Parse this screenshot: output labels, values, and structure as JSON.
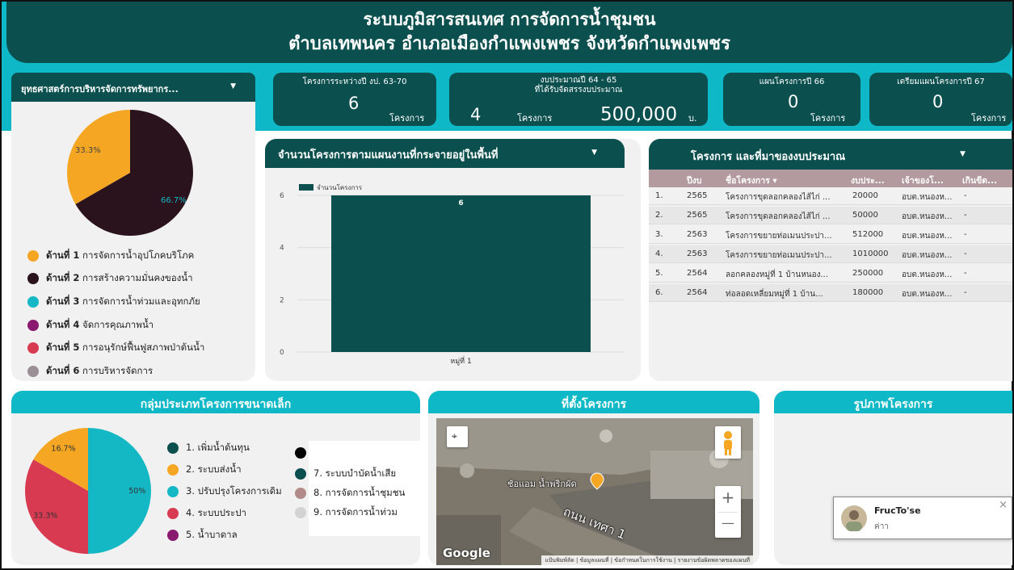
{
  "header": {
    "title_line1": "ระบบภูมิสารสนเทศ การจัดการน้ำชุมชน",
    "title_line2": "ตำบลเทพนคร อำเภอเมืองกำแพงเพชร จังหวัดกำแพงเพชร"
  },
  "filter": {
    "label": "ยุทธศาสตร์การบริหารจัดการทรัพยากร..."
  },
  "kpis": {
    "k1": {
      "label": "โครงการระหว่างปี งป. 63-70",
      "value": "6",
      "unit": "โครงการ"
    },
    "k2": {
      "label_line1": "งบประมาณปี 64 - 65",
      "label_line2": "ที่ได้รับจัดสรรงบประมาณ",
      "count": "4",
      "count_unit": "โครงการ",
      "budget": "500,000",
      "budget_unit": "บ."
    },
    "k3": {
      "label": "แผนโครงการปี 66",
      "value": "0",
      "unit": "โครงการ"
    },
    "k4": {
      "label": "เตรียมแผนโครงการปี 67",
      "value": "0",
      "unit": "โครงการ"
    }
  },
  "strategy_pie": {
    "slices": [
      {
        "label": "33.3%",
        "value": 33.3,
        "color": "#f5a623"
      },
      {
        "label": "66.7%",
        "value": 66.7,
        "color": "#2b131d"
      }
    ],
    "legend": [
      {
        "bold": "ด้านที่ 1",
        "text": "การจัดการน้ำอุปโภคบริโภค",
        "color": "#f5a623"
      },
      {
        "bold": "ด้านที่ 2",
        "text": "การสร้างความมั่นคงของน้ำ",
        "color": "#2b131d"
      },
      {
        "bold": "ด้านที่ 3",
        "text": "การจัดการน้ำท่วมและอุทกภัย",
        "color": "#14b8c4"
      },
      {
        "bold": "ด้านที่ 4",
        "text": "จัดการคุณภาพน้ำ",
        "color": "#8a1a6f"
      },
      {
        "bold": "ด้านที่ 5",
        "text": "การอนุรักษ์ฟื้นฟูสภาพป่าต้นน้ำ",
        "color": "#d83a52"
      },
      {
        "bold": "ด้านที่ 6",
        "text": "การบริหารจัดการ",
        "color": "#9a8f95"
      }
    ]
  },
  "bar_card": {
    "title": "จำนวนโครงการตามแผนงานที่กระจายอยู่ในพื้นที่"
  },
  "chart_data": [
    {
      "type": "bar",
      "categories": [
        "หมู่ที่ 1"
      ],
      "series": [
        {
          "name": "จำนวนโครงการ",
          "values": [
            6
          ]
        }
      ],
      "ylim": [
        0,
        6
      ],
      "yticks": [
        "0",
        "2",
        "4",
        "6"
      ],
      "data_labels": [
        "6"
      ],
      "color": "#0b4f4f"
    },
    {
      "type": "pie",
      "slices": [
        {
          "label": "50%",
          "value": 50,
          "color": "#14b8c4"
        },
        {
          "label": "33.3%",
          "value": 33.3,
          "color": "#d83a52"
        },
        {
          "label": "16.7%",
          "value": 16.7,
          "color": "#f5a623"
        }
      ]
    }
  ],
  "table_card": {
    "title": "โครงการ และที่มาของงบประมาณ",
    "headers": [
      "ปีงบ",
      "ชื่อโครงการ ▾",
      "งบประ...",
      "เจ้าของโ...",
      "เกินขีด..."
    ],
    "rows": [
      {
        "n": "1.",
        "year": "2565",
        "name": "โครงการขุดลอกคลองไส้ไก่ ...",
        "budget": "20000",
        "owner": "อบต.หนองห...",
        "over": "-"
      },
      {
        "n": "2.",
        "year": "2565",
        "name": "โครงการขุดลอกคลองไส้ไก่ ...",
        "budget": "50000",
        "owner": "อบต.หนองห...",
        "over": "-"
      },
      {
        "n": "3.",
        "year": "2563",
        "name": "โครงการขยายท่อเมนประปา...",
        "budget": "512000",
        "owner": "อบต.หนองห...",
        "over": "-"
      },
      {
        "n": "4.",
        "year": "2563",
        "name": "โครงการขยายท่อเมนประปา...",
        "budget": "1010000",
        "owner": "อบต.หนองห...",
        "over": "-"
      },
      {
        "n": "5.",
        "year": "2564",
        "name": "ลอกคลองหมู่ที่ 1 บ้านหนอง...",
        "budget": "250000",
        "owner": "อบต.หนองห...",
        "over": "-"
      },
      {
        "n": "6.",
        "year": "2564",
        "name": "ท่อลอดเหลี่ยมหมู่ที่ 1 บ้าน...",
        "budget": "180000",
        "owner": "อบต.หนองห...",
        "over": "-"
      }
    ]
  },
  "small_projects": {
    "title": "กลุ่มประเภทโครงการขนาดเล็ก",
    "legend_left": [
      {
        "text": "1. เพิ่มน้ำต้นทุน",
        "color": "#0b4f4f"
      },
      {
        "text": "2. ระบบส่งน้ำ",
        "color": "#f5a623"
      },
      {
        "text": "3. ปรับปรุงโครงการเดิม",
        "color": "#14b8c4"
      },
      {
        "text": "4. ระบบประปา",
        "color": "#d83a52"
      },
      {
        "text": "5. น้ำบาดาล",
        "color": "#8a1a6f"
      }
    ],
    "legend_right": [
      {
        "text": "",
        "color": "#000000"
      },
      {
        "text": "7. ระบบบำบัดน้ำเสีย",
        "color": "#0b4f4f"
      },
      {
        "text": "8. การจัดการน้ำชุมชน",
        "color": "#b38a8a"
      },
      {
        "text": "9. การจัดการน้ำท่วม",
        "color": "#d3d3d3"
      }
    ]
  },
  "map_card": {
    "title": "ที่ตั้งโครงการ",
    "place_label": "ช้อแอม น้ำพริกผัด",
    "road_label": "ถนน เทศา 1",
    "google": "Google",
    "footer": "แป้นพิมพ์ลัด | ข้อมูลแผนที่ | ข้อกำหนดในการใช้งาน | รายงานข้อผิดพลาดของแผนที่",
    "zoom_in": "+",
    "zoom_out": "—"
  },
  "photo_card": {
    "title": "รูปภาพโครงการ"
  },
  "notification": {
    "name": "FrucTo'se",
    "text": "ค่าา",
    "close": "×"
  },
  "icons": {
    "dropdown": "▼"
  }
}
